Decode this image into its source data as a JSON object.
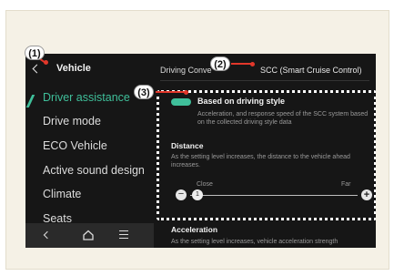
{
  "sidebar": {
    "title": "Vehicle",
    "items": [
      {
        "label": "Driver assistance",
        "active": true
      },
      {
        "label": "Drive mode",
        "active": false
      },
      {
        "label": "ECO Vehicle",
        "active": false
      },
      {
        "label": "Active sound design",
        "active": false
      },
      {
        "label": "Climate",
        "active": false
      },
      {
        "label": "Seats",
        "active": false
      }
    ]
  },
  "header": {
    "breadcrumb_left": "Driving Conve",
    "breadcrumb_right": "SCC (Smart Cruise Control)"
  },
  "option": {
    "title": "Based on driving style",
    "description": "Acceleration, and response speed of the SCC system based on the collected driving style data",
    "enabled": true
  },
  "distance": {
    "title": "Distance",
    "description": "As the setting level increases, the distance to the vehicle ahead increases.",
    "min_label": "Close",
    "max_label": "Far",
    "value": "1",
    "minus_symbol": "−",
    "plus_symbol": "+"
  },
  "acceleration": {
    "title": "Acceleration",
    "description": "As the setting level increases, vehicle acceleration strength"
  },
  "callouts": [
    "(1)",
    "(2)",
    "(3)"
  ],
  "bottom_bar": {
    "icons": [
      "back-icon",
      "home-icon",
      "menu-icon"
    ]
  },
  "colors": {
    "accent": "#3fbf9a",
    "screen_bg": "#161616",
    "leader": "#e2372a",
    "panel_bg": "#f5f1e6"
  }
}
